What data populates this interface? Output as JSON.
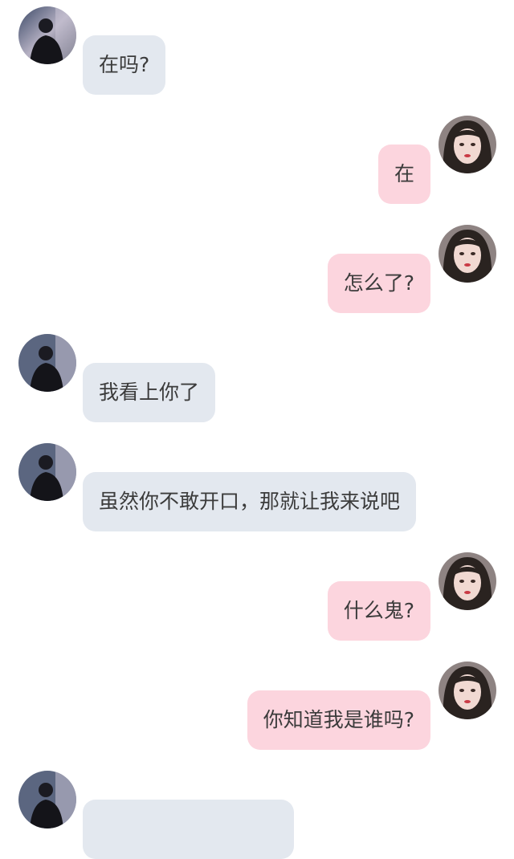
{
  "conversation": {
    "messages": [
      {
        "side": "left",
        "sender": "contact",
        "text": "在吗?"
      },
      {
        "side": "right",
        "sender": "me",
        "text": "在"
      },
      {
        "side": "right",
        "sender": "me",
        "text": "怎么了?"
      },
      {
        "side": "left",
        "sender": "contact",
        "text": "我看上你了"
      },
      {
        "side": "left",
        "sender": "contact",
        "text": "虽然你不敢开口，那就让我来说吧"
      },
      {
        "side": "right",
        "sender": "me",
        "text": "什么鬼?"
      },
      {
        "side": "right",
        "sender": "me",
        "text": "你知道我是谁吗?"
      },
      {
        "side": "left",
        "sender": "contact",
        "text": ""
      }
    ]
  },
  "colors": {
    "left_bubble": "#e3e8ef",
    "right_bubble": "#fcd5de",
    "text": "#3b3b3b",
    "background": "#ffffff"
  }
}
